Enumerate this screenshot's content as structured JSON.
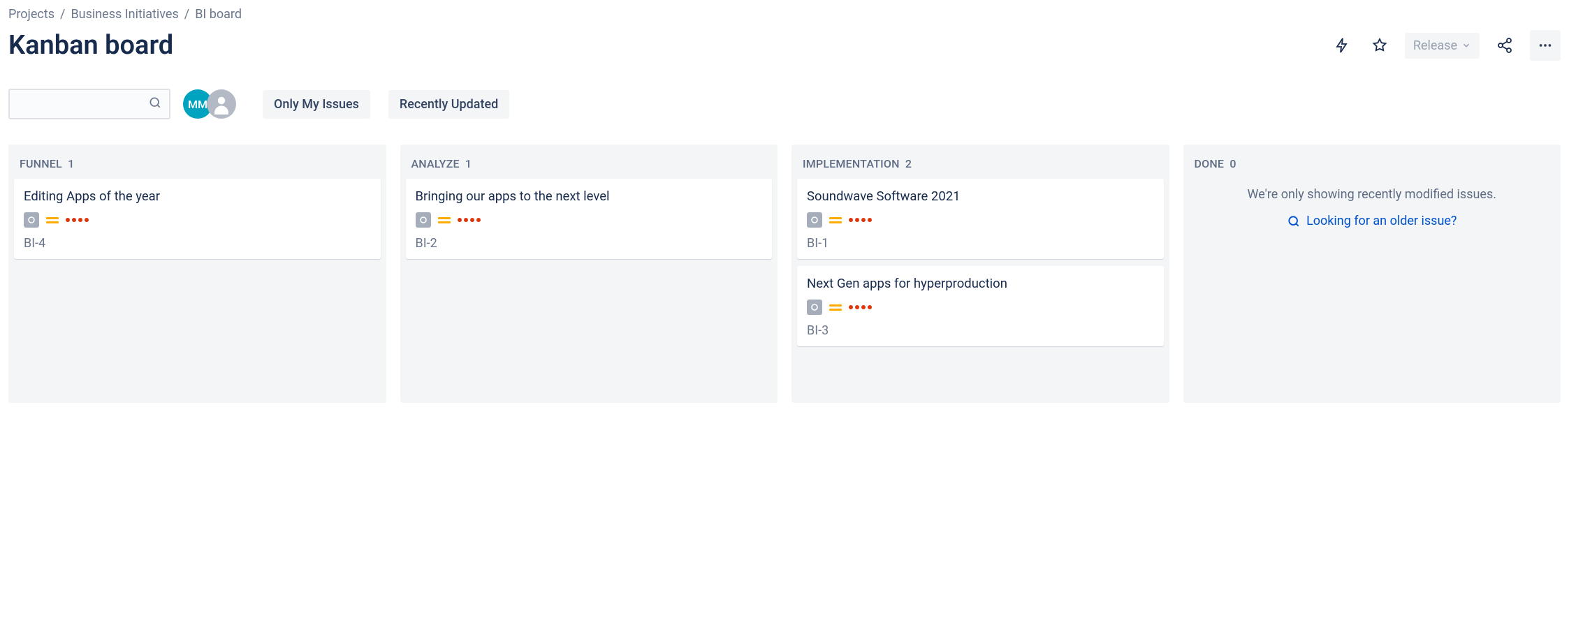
{
  "breadcrumbs": [
    "Projects",
    "Business Initiatives",
    "BI board"
  ],
  "page_title": "Kanban board",
  "header": {
    "release_label": "Release"
  },
  "avatars": {
    "mm_initials": "MM"
  },
  "filters": {
    "only_my": "Only My Issues",
    "recent": "Recently Updated"
  },
  "columns": [
    {
      "name": "FUNNEL",
      "count": 1
    },
    {
      "name": "ANALYZE",
      "count": 1
    },
    {
      "name": "IMPLEMENTATION",
      "count": 2
    },
    {
      "name": "DONE",
      "count": 0
    }
  ],
  "cards": {
    "funnel": [
      {
        "title": "Editing Apps of the year",
        "key": "BI-4"
      }
    ],
    "analyze": [
      {
        "title": "Bringing our apps to the next level",
        "key": "BI-2"
      }
    ],
    "implementation": [
      {
        "title": "Soundwave Software 2021",
        "key": "BI-1"
      },
      {
        "title": "Next Gen apps for hyperproduction",
        "key": "BI-3"
      }
    ]
  },
  "done": {
    "message": "We're only showing recently modified issues.",
    "link": "Looking for an older issue?"
  }
}
